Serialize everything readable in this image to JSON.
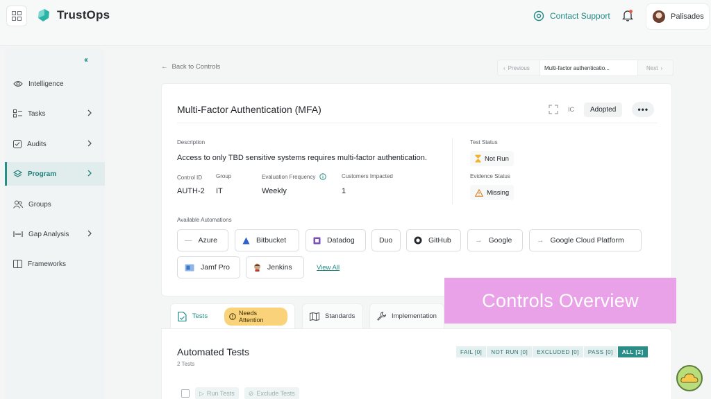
{
  "app": {
    "name": "TrustOps"
  },
  "header": {
    "support_label": "Contact Support",
    "user_name": "Palisades"
  },
  "sidebar": {
    "items": [
      {
        "label": "Intelligence",
        "icon": "eye-icon",
        "has_chevron": false,
        "active": false
      },
      {
        "label": "Tasks",
        "icon": "tasks-icon",
        "has_chevron": true,
        "active": false
      },
      {
        "label": "Audits",
        "icon": "audit-icon",
        "has_chevron": true,
        "active": false
      },
      {
        "label": "Program",
        "icon": "layers-icon",
        "has_chevron": true,
        "active": true
      },
      {
        "label": "Groups",
        "icon": "users-icon",
        "has_chevron": false,
        "active": false
      },
      {
        "label": "Gap Analysis",
        "icon": "gap-icon",
        "has_chevron": true,
        "active": false
      },
      {
        "label": "Frameworks",
        "icon": "book-icon",
        "has_chevron": false,
        "active": false
      }
    ]
  },
  "nav": {
    "back_label": "Back to Controls",
    "previous_label": "Previous",
    "current_label": "Multi-factor authenticatio...",
    "next_label": "Next"
  },
  "control": {
    "title": "Multi-Factor Authentication (MFA)",
    "ic_label": "IC",
    "status_button": "Adopted",
    "description_label": "Description",
    "description": "Access to only TBD sensitive systems requires multi-factor authentication.",
    "control_id_label": "Control ID",
    "control_id": "AUTH-2",
    "group_label": "Group",
    "group": "IT",
    "frequency_label": "Evaluation Frequency",
    "frequency": "Weekly",
    "customers_label": "Customers Impacted",
    "customers": "1",
    "test_status_label": "Test Status",
    "test_status": "Not Run",
    "evidence_status_label": "Evidence Status",
    "evidence_status": "Missing",
    "automations_label": "Available Automations",
    "automations": [
      "Azure",
      "Bitbucket",
      "Datadog",
      "Duo",
      "GitHub",
      "Google",
      "Google Cloud Platform",
      "Jamf Pro",
      "Jenkins"
    ],
    "view_all": "View All"
  },
  "tabs": [
    {
      "label": "Tests",
      "badge": "Needs Attention"
    },
    {
      "label": "Standards"
    },
    {
      "label": "Implementation"
    }
  ],
  "tests": {
    "title": "Automated Tests",
    "count": "2 Tests",
    "filters": [
      "FAIL [0]",
      "NOT RUN [0]",
      "EXCLUDED [0]",
      "PASS [0]",
      "ALL [2]"
    ],
    "run_label": "Run Tests",
    "exclude_label": "Exclude Tests"
  },
  "overlay": {
    "text": "Controls Overview"
  },
  "colors": {
    "accent": "#2a8d87",
    "overlay": "#e9a1e8",
    "warning": "#f9d27a"
  }
}
